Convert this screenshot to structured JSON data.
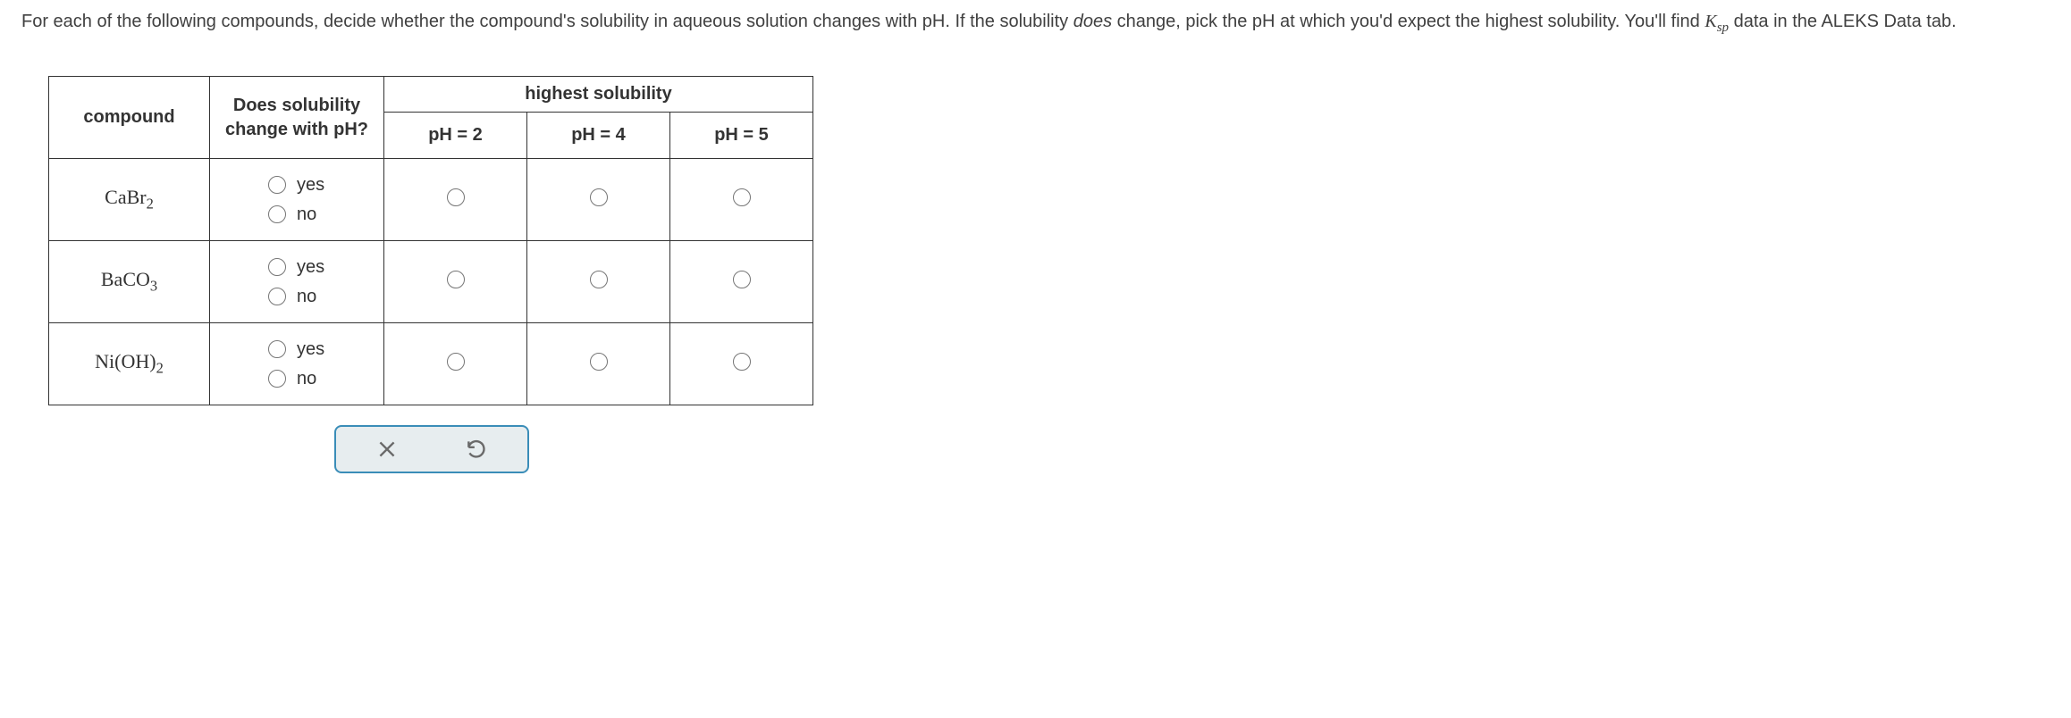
{
  "question": {
    "part1": "For each of the following compounds, decide whether the compound's solubility in aqueous solution changes with pH. If the solubility ",
    "does": "does",
    "part2": " change, pick the pH at which you'd expect the highest solubility. You'll find ",
    "ksp_k": "K",
    "ksp_sp": "sp",
    "part3": " data in the ALEKS Data tab."
  },
  "headers": {
    "compound": "compound",
    "change": "Does solubility change with pH?",
    "solubility": "highest solubility",
    "ph2": "pH = 2",
    "ph4": "pH = 4",
    "ph5": "pH = 5"
  },
  "labels": {
    "yes": "yes",
    "no": "no"
  },
  "compounds": {
    "c1_a": "CaBr",
    "c1_b": "2",
    "c2_a": "BaCO",
    "c2_b": "3",
    "c3_a": "Ni",
    "c3_b": "OH",
    "c3_c": "2"
  }
}
